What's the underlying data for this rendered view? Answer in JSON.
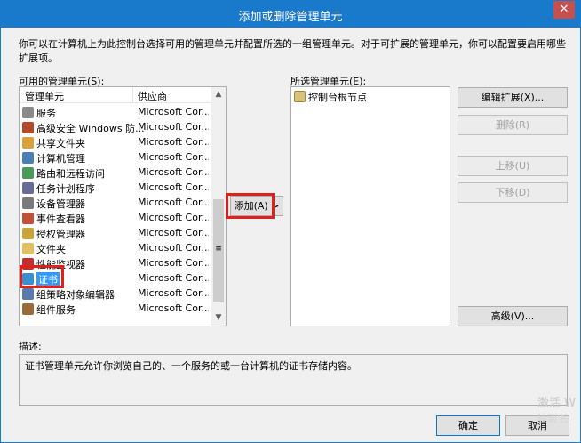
{
  "window": {
    "title": "添加或删除管理单元",
    "close": "✕"
  },
  "intro": "你可以在计算机上为此控制台选择可用的管理单元并配置所选的一组管理单元。对于可扩展的管理单元，你可以配置要启用哪些扩展项。",
  "available": {
    "label": "可用的管理单元(S):",
    "col_name": "管理单元",
    "col_vendor": "供应商",
    "items": [
      {
        "name": "服务",
        "vendor": "Microsoft Cor...",
        "icon": "gear-icon"
      },
      {
        "name": "高级安全 Windows 防...",
        "vendor": "Microsoft Cor...",
        "icon": "firewall-icon"
      },
      {
        "name": "共享文件夹",
        "vendor": "Microsoft Cor...",
        "icon": "shared-folder-icon"
      },
      {
        "name": "计算机管理",
        "vendor": "Microsoft Cor...",
        "icon": "computer-management-icon"
      },
      {
        "name": "路由和远程访问",
        "vendor": "Microsoft Cor...",
        "icon": "routing-icon"
      },
      {
        "name": "任务计划程序",
        "vendor": "Microsoft Cor...",
        "icon": "clock-icon"
      },
      {
        "name": "设备管理器",
        "vendor": "Microsoft Cor...",
        "icon": "device-manager-icon"
      },
      {
        "name": "事件查看器",
        "vendor": "Microsoft Cor...",
        "icon": "event-viewer-icon"
      },
      {
        "name": "授权管理器",
        "vendor": "Microsoft Cor...",
        "icon": "authorization-icon"
      },
      {
        "name": "文件夹",
        "vendor": "Microsoft Cor...",
        "icon": "folder-icon"
      },
      {
        "name": "性能监视器",
        "vendor": "Microsoft Cor...",
        "icon": "performance-icon"
      },
      {
        "name": "证书",
        "vendor": "Microsoft Cor...",
        "icon": "certificate-icon"
      },
      {
        "name": "组策略对象编辑器",
        "vendor": "Microsoft Cor...",
        "icon": "group-policy-icon"
      },
      {
        "name": "组件服务",
        "vendor": "Microsoft Cor...",
        "icon": "component-services-icon"
      }
    ],
    "selected_index": 11
  },
  "buttons": {
    "add": "添加(A) >",
    "edit_extensions": "编辑扩展(X)...",
    "remove": "删除(R)",
    "move_up": "上移(U)",
    "move_down": "下移(D)",
    "advanced": "高级(V)...",
    "ok": "确定",
    "cancel": "取消"
  },
  "selected": {
    "label": "所选管理单元(E):",
    "root": "控制台根节点"
  },
  "description": {
    "label": "描述:",
    "text": "证书管理单元允许你浏览自己的、一个服务的或一台计算机的证书存储内容。"
  },
  "watermark": {
    "line1": "激活 W",
    "line2": "转到'控"
  },
  "colors": {
    "title_bar": "#1979ca",
    "selection": "#3399ff",
    "highlight": "#e0201b"
  }
}
